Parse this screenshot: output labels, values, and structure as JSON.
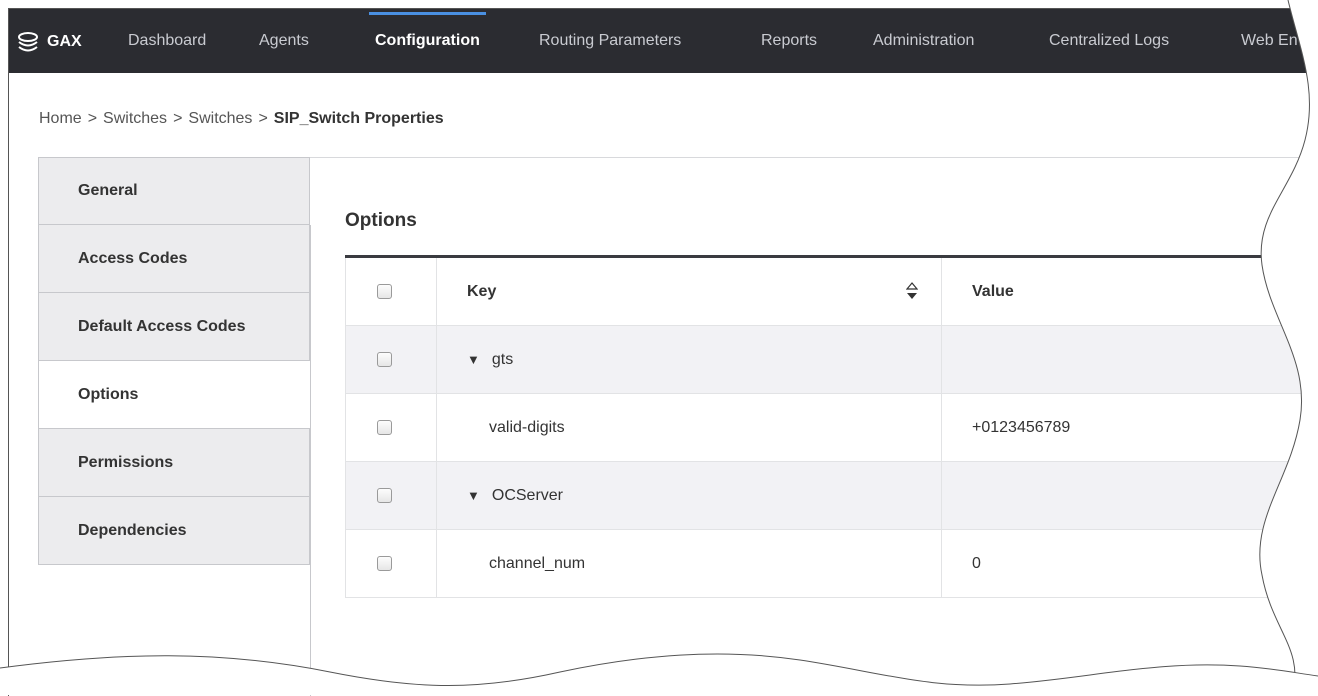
{
  "topbar": {
    "brand": "GAX",
    "nav": [
      "Dashboard",
      "Agents",
      "Configuration",
      "Routing Parameters",
      "Reports",
      "Administration",
      "Centralized Logs",
      "Web En"
    ],
    "active": "Configuration"
  },
  "breadcrumb": {
    "items": [
      "Home",
      "Switches",
      "Switches"
    ],
    "separator": ">",
    "current": "SIP_Switch Properties"
  },
  "sidebar": {
    "items": [
      {
        "label": "General"
      },
      {
        "label": "Access Codes"
      },
      {
        "label": "Default Access Codes"
      },
      {
        "label": "Options"
      },
      {
        "label": "Permissions"
      },
      {
        "label": "Dependencies"
      }
    ],
    "active": "Options"
  },
  "options": {
    "title": "Options",
    "columns": {
      "key": "Key",
      "value": "Value"
    },
    "rows": [
      {
        "key": "gts",
        "value": "",
        "section": true
      },
      {
        "key": "valid-digits",
        "value": "+0123456789",
        "section": false
      },
      {
        "key": "OCServer",
        "value": "",
        "section": true
      },
      {
        "key": "channel_num",
        "value": "0",
        "section": false
      }
    ]
  },
  "colors": {
    "topbar": "#2b2c31",
    "accent": "#4a90e2",
    "sidebar_bg": "#ececee",
    "row_alt": "#f2f2f5"
  },
  "icons": {
    "brand": "stacked-discs-icon",
    "expand": "triangle-down-icon",
    "sort": "sort-arrows-icon"
  }
}
